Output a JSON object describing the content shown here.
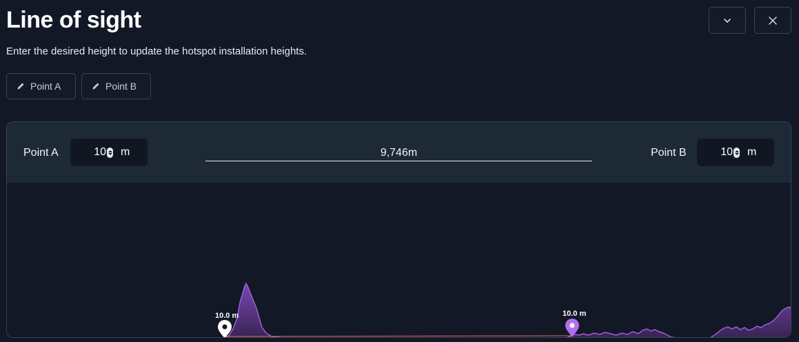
{
  "header": {
    "title": "Line of sight",
    "subtitle": "Enter the desired height to update the hotspot installation heights."
  },
  "window_controls": {
    "collapse_icon": "chevron-down-icon",
    "close_icon": "close-icon"
  },
  "edit_buttons": [
    {
      "label": "Point A",
      "icon": "pencil-icon"
    },
    {
      "label": "Point B",
      "icon": "pencil-icon"
    }
  ],
  "heights": {
    "point_a": {
      "label": "Point A",
      "value": "10",
      "unit": "m"
    },
    "point_b": {
      "label": "Point B",
      "value": "10",
      "unit": "m"
    }
  },
  "distance": "9,746m",
  "profile": {
    "marker_a_label": "10.0 m",
    "marker_b_label": "10.0 m",
    "marker_a_color": "#ffffff",
    "marker_b_color": "#b36ef0",
    "terrain_color": "#7b45b0",
    "sightline_color": "#e0685a"
  }
}
